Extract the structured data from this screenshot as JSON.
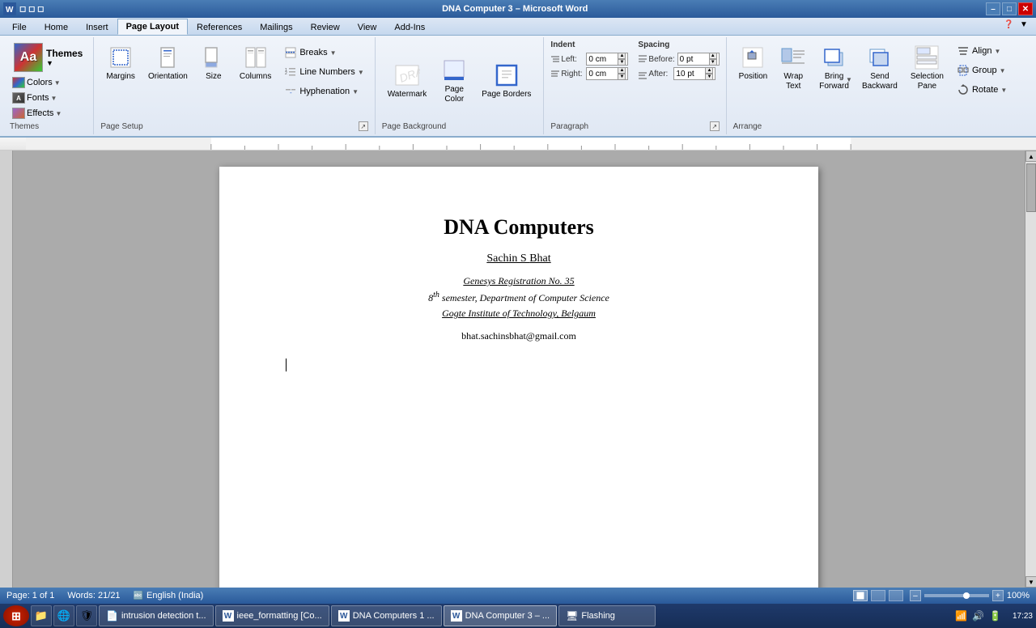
{
  "titlebar": {
    "title": "DNA Computer 3 – Microsoft Word",
    "buttons": {
      "minimize": "–",
      "maximize": "□",
      "close": "✕"
    }
  },
  "ribbon": {
    "tabs": [
      {
        "id": "file",
        "label": "File"
      },
      {
        "id": "home",
        "label": "Home"
      },
      {
        "id": "insert",
        "label": "Insert"
      },
      {
        "id": "page_layout",
        "label": "Page Layout",
        "active": true
      },
      {
        "id": "references",
        "label": "References"
      },
      {
        "id": "mailings",
        "label": "Mailings"
      },
      {
        "id": "review",
        "label": "Review"
      },
      {
        "id": "view",
        "label": "View"
      },
      {
        "id": "add_ins",
        "label": "Add-Ins"
      }
    ],
    "groups": {
      "themes": {
        "label": "Themes",
        "themes_btn": "Themes",
        "colors_btn": "Colors",
        "fonts_btn": "Fonts",
        "effects_btn": "Effects"
      },
      "page_setup": {
        "label": "Page Setup",
        "buttons": [
          "Margins",
          "Orientation",
          "Size",
          "Columns"
        ],
        "dropdown_buttons": [
          "Breaks",
          "Line Numbers",
          "Hyphenation"
        ],
        "expand_icon": "↗"
      },
      "page_background": {
        "label": "Page Background",
        "buttons": [
          "Watermark",
          "Page Color",
          "Page Borders"
        ]
      },
      "paragraph": {
        "label": "Paragraph",
        "indent": {
          "label": "Indent",
          "left_label": "Left:",
          "left_value": "0 cm",
          "right_label": "Right:",
          "right_value": "0 cm"
        },
        "spacing": {
          "label": "Spacing",
          "before_label": "Before:",
          "before_value": "0 pt",
          "after_label": "After:",
          "after_value": "10 pt"
        },
        "expand_icon": "↗"
      },
      "arrange": {
        "label": "Arrange",
        "buttons": [
          "Position",
          "Wrap Text",
          "Bring Forward",
          "Send Backward",
          "Selection Pane"
        ],
        "align_btn": "Align",
        "group_btn": "Group",
        "rotate_btn": "Rotate"
      }
    }
  },
  "document": {
    "title": "DNA Computers",
    "author_name": "Sachin S ",
    "author_underline": "Bhat",
    "reg_line1": "Genesys Registration No. 35",
    "reg_line2_prefix": "8",
    "reg_line2_super": "th",
    "reg_line2_suffix": " semester, Department of Computer Science",
    "reg_line3": "Gogte Institute of Technology, Belgaum",
    "email": "bhat.sachinsbhat@gmail.com"
  },
  "statusbar": {
    "page": "Page: 1 of 1",
    "words": "Words: 21/21",
    "language": "English (India)",
    "zoom": "100%"
  },
  "taskbar": {
    "items": [
      {
        "id": "start",
        "label": "⊞",
        "type": "start"
      },
      {
        "id": "quick1",
        "icon": "📁",
        "type": "icon"
      },
      {
        "id": "quick2",
        "icon": "🌐",
        "type": "icon"
      },
      {
        "id": "quick3",
        "icon": "🛡",
        "type": "icon"
      },
      {
        "id": "task1",
        "label": "intrusion detection t...",
        "icon": "📄",
        "active": false
      },
      {
        "id": "task2",
        "label": "ieee_formatting [Co...",
        "icon": "W",
        "active": false
      },
      {
        "id": "task3",
        "label": "DNA Computers 1 ...",
        "icon": "W",
        "active": false
      },
      {
        "id": "task4",
        "label": "DNA Computer 3 – ...",
        "icon": "W",
        "active": true
      },
      {
        "id": "task5",
        "label": "Flashing",
        "icon": "🖥",
        "active": false
      }
    ],
    "time": "17:23",
    "date": "17:23"
  }
}
